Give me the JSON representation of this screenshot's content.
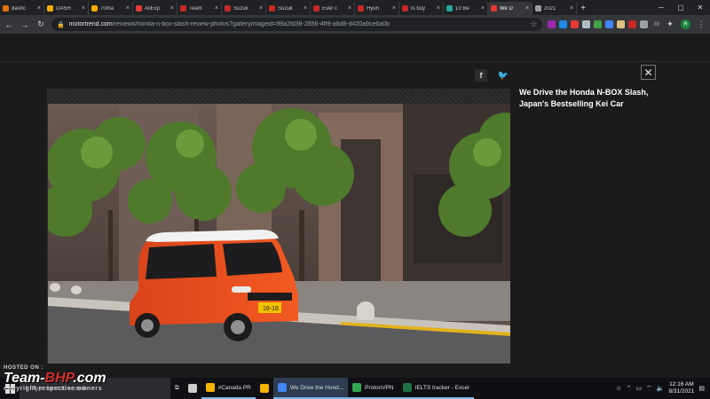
{
  "browser": {
    "tabs": [
      {
        "label": "dashc",
        "color": "#e8710a"
      },
      {
        "label": "DASH",
        "color": "#f9ab00"
      },
      {
        "label": "70ma",
        "color": "#f9ab00"
      },
      {
        "label": "AliExp",
        "color": "#e53935"
      },
      {
        "label": "Team",
        "color": "#c62828"
      },
      {
        "label": "Suzuk",
        "color": "#c62828"
      },
      {
        "label": "Suzuk",
        "color": "#c62828"
      },
      {
        "label": "Ever c",
        "color": "#c62828"
      },
      {
        "label": "Hyun",
        "color": "#c62828"
      },
      {
        "label": "Is buy",
        "color": "#c62828"
      },
      {
        "label": "10 Be",
        "color": "#26a69a"
      },
      {
        "label": "We D",
        "color": "#e53935",
        "active": true
      },
      {
        "label": "2021",
        "color": "#9e9e9e"
      }
    ],
    "new_tab": "+",
    "url_domain": "motortrend.com",
    "url_path": "/reviews/honda-n-box-slash-review-photos?galleryimageid=99a2fd38-2856-4ff9-a6d8-d420a9ce6a0b",
    "profile_initial": "R",
    "ext_badge": "39",
    "extensions": [
      "#9c27b0",
      "#1e88e5",
      "#e53935",
      "#b0bec5",
      "#43a047",
      "#4285f4",
      "#e0c080",
      "#c62828",
      "#9aa0a6"
    ]
  },
  "gallery": {
    "caption_title": "We Drive the Honda N-BOX Slash, Japan's Bestselling Kei Car",
    "plate_text": "16-18",
    "share_fb": "f",
    "share_tw": "🐦"
  },
  "taskbar": {
    "search_placeholder": "Type here to search",
    "apps": [
      {
        "label": "",
        "color": "#ccc",
        "open": false
      },
      {
        "label": "#Canada PR",
        "color": "#f4b400",
        "open": true
      },
      {
        "label": "",
        "color": "#f4b400",
        "open": false
      },
      {
        "label": "We Drive the Hond...",
        "color": "#4285f4",
        "open": true,
        "active": true
      },
      {
        "label": "ProtonVPN",
        "color": "#34a853",
        "open": true
      },
      {
        "label": "IELTS tracker - Excel",
        "color": "#1e7145",
        "open": true
      }
    ],
    "time": "12:16 AM",
    "date": "8/31/2021"
  },
  "watermark": {
    "hosted": "HOSTED ON :",
    "logo_main": "Team-",
    "logo_accent": "BHP",
    "logo_suffix": ".com",
    "copyright": "copyright respective owners"
  }
}
